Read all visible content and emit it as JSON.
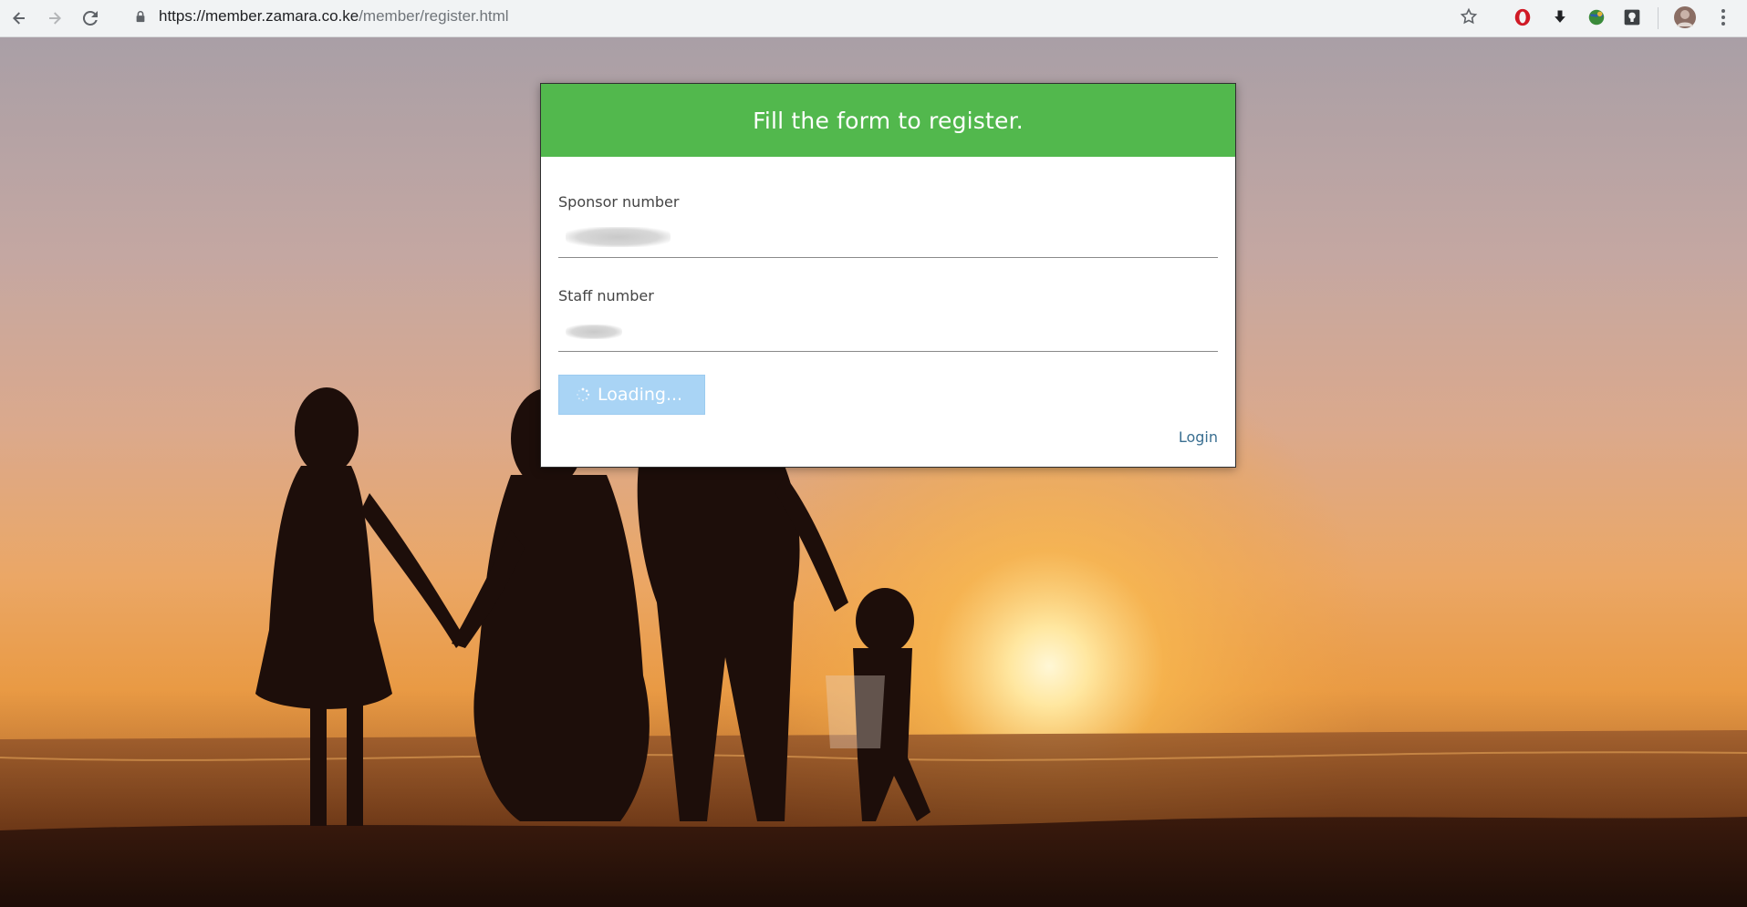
{
  "browser": {
    "url_host": "https://member.zamara.co.ke",
    "url_path": "/member/register.html",
    "icons": {
      "back": "back-arrow-icon",
      "forward": "forward-arrow-icon",
      "reload": "reload-icon",
      "secure": "lock-icon",
      "bookmark": "star-icon",
      "menu": "kebab-menu-icon"
    }
  },
  "modal": {
    "title": "Fill the form to register.",
    "sponsor_label": "Sponsor number",
    "staff_label": "Staff number",
    "button_label": "Loading...",
    "login_link": "Login"
  },
  "colors": {
    "header_green": "#52b84d",
    "button_disabled": "#a9d4f5",
    "link": "#3a6f91"
  }
}
